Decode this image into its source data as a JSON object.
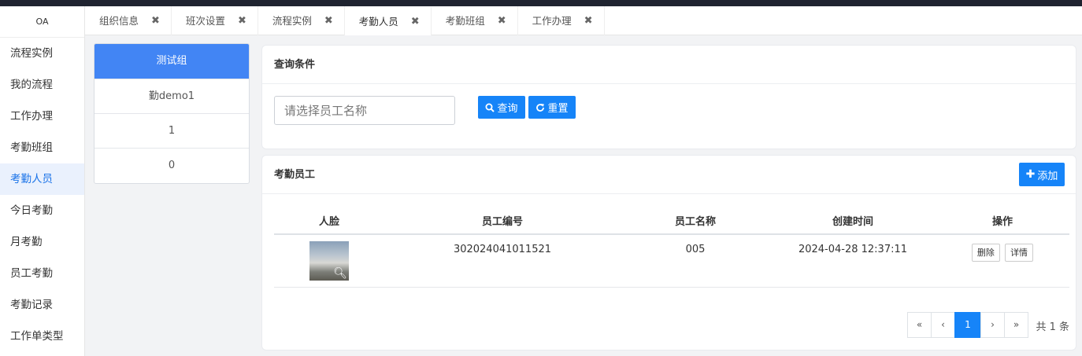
{
  "sidebar": {
    "logo": "OA",
    "items": [
      {
        "label": "流程实例"
      },
      {
        "label": "我的流程"
      },
      {
        "label": "工作办理"
      },
      {
        "label": "考勤班组"
      },
      {
        "label": "考勤人员"
      },
      {
        "label": "今日考勤"
      },
      {
        "label": "月考勤"
      },
      {
        "label": "员工考勤"
      },
      {
        "label": "考勤记录"
      },
      {
        "label": "工作单类型"
      }
    ],
    "active": "考勤人员"
  },
  "tabs": [
    {
      "label": "组织信息",
      "close": "✖"
    },
    {
      "label": "班次设置",
      "close": "✖"
    },
    {
      "label": "流程实例",
      "close": "✖"
    },
    {
      "label": "考勤人员",
      "close": "✖"
    },
    {
      "label": "考勤班组",
      "close": "✖"
    },
    {
      "label": "工作办理",
      "close": "✖"
    }
  ],
  "groups": [
    {
      "label": "测试组"
    },
    {
      "label": "勤demo1"
    },
    {
      "label": "1"
    },
    {
      "label": "0"
    }
  ],
  "query": {
    "title": "查询条件",
    "placeholder": "请选择员工名称",
    "query_label": "查询",
    "reset_label": "重置"
  },
  "staff": {
    "title": "考勤员工",
    "add_label": "添加",
    "columns": [
      "人脸",
      "员工编号",
      "员工名称",
      "创建时间",
      "操作"
    ],
    "rows": [
      {
        "face_icon": "zoom-icon",
        "employee_no": "302024041011521",
        "employee_name": "005",
        "created": "2024-04-28 12:37:11",
        "delete_label": "删除",
        "detail_label": "详情"
      }
    ]
  },
  "pagination": {
    "first": "«",
    "prev": "‹",
    "current": "1",
    "next": "›",
    "last": "»",
    "total": "共 1 条"
  },
  "colors": {
    "accent": "#1684f8",
    "active_group": "#4285f4"
  }
}
